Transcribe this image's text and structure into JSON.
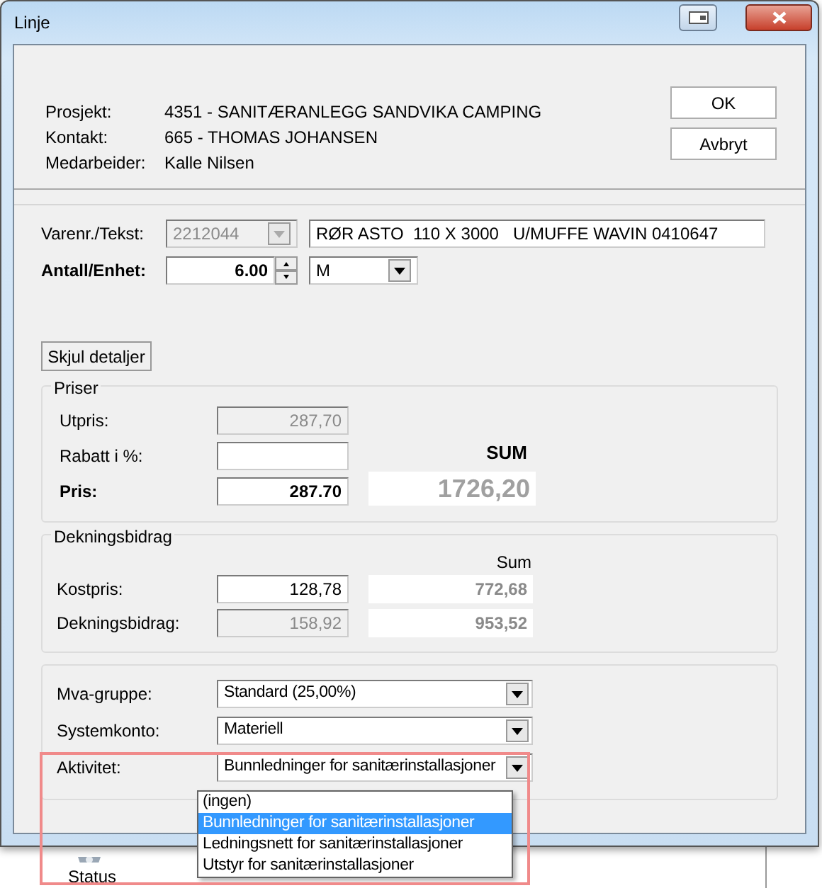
{
  "window": {
    "title": "Linje"
  },
  "header": {
    "fields": [
      {
        "label": "Prosjekt:",
        "value": "4351 - SANITÆRANLEGG SANDVIKA CAMPING"
      },
      {
        "label": "Kontakt:",
        "value": "665 - THOMAS JOHANSEN"
      },
      {
        "label": "Medarbeider:",
        "value": "Kalle Nilsen"
      }
    ],
    "buttons": [
      "OK",
      "Avbryt"
    ]
  },
  "item": {
    "varenr_label": "Varenr./Tekst:",
    "varenr": "2212044",
    "varenr_disabled": true,
    "text": "RØR ASTO  110 X 3000   U/MUFFE WAVIN 0410647",
    "quantity_label": "Antall/Enhet:",
    "quantity": "6.00",
    "unit": "M"
  },
  "toggle_button": "Skjul detaljer",
  "prices": {
    "title": "Priser",
    "sum_heading": "SUM",
    "sum": "1726,20",
    "rows": [
      {
        "label": "Utpris:",
        "value": "287,70",
        "disabled": true,
        "bold": false
      },
      {
        "label": "Rabatt i %:",
        "disabled": false,
        "bold": false
      },
      {
        "label": "Pris:",
        "value": "287.70",
        "disabled": false,
        "bold": true
      }
    ]
  },
  "margin": {
    "title": "Dekningsbidrag",
    "sum_heading": "Sum",
    "rows": [
      {
        "label": "Kostpris:",
        "value": "128,78",
        "disabled": false,
        "sum": "772,68"
      },
      {
        "label": "Dekningsbidrag:",
        "value": "158,92",
        "disabled": true,
        "sum": "953,52"
      }
    ]
  },
  "settings": {
    "rows": [
      {
        "label": "Mva-gruppe:",
        "value": "Standard (25,00%)"
      },
      {
        "label": "Systemkonto:",
        "value": "Materiell"
      },
      {
        "label": "Aktivitet:",
        "value": "Bunnledninger for sanitærinstallasjoner"
      }
    ]
  },
  "dropdown": {
    "options": [
      {
        "label": "(ingen)",
        "selected": false
      },
      {
        "label": "Bunnledninger for sanitærinstallasjoner",
        "selected": true
      },
      {
        "label": "Ledningsnett for sanitærinstallasjoner",
        "selected": false
      },
      {
        "label": "Utstyr for sanitærinstallasjoner",
        "selected": false
      }
    ]
  },
  "background": {
    "status_label": "Status"
  }
}
